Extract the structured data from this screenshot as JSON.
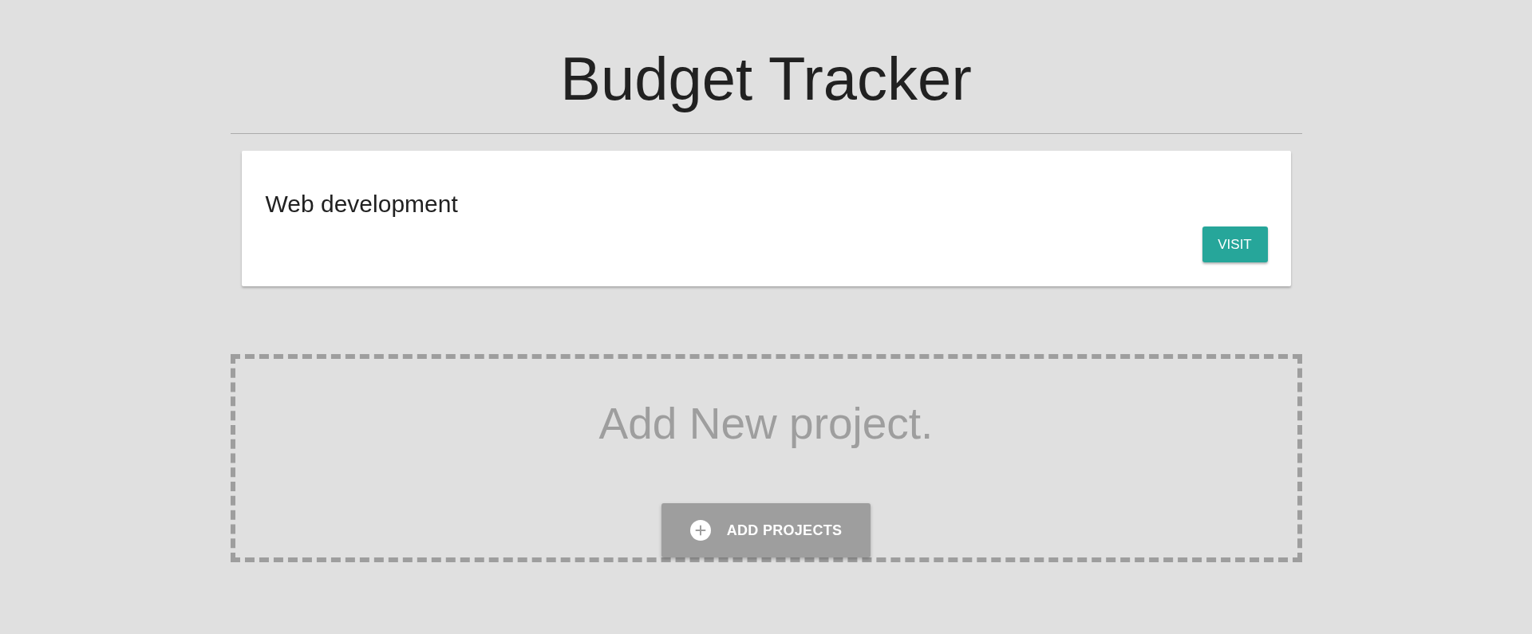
{
  "header": {
    "title": "Budget Tracker"
  },
  "projects": [
    {
      "name": "Web development",
      "action": "VISIT"
    }
  ],
  "add_project": {
    "prompt": "Add New project.",
    "button": "ADD PROJECTS"
  }
}
